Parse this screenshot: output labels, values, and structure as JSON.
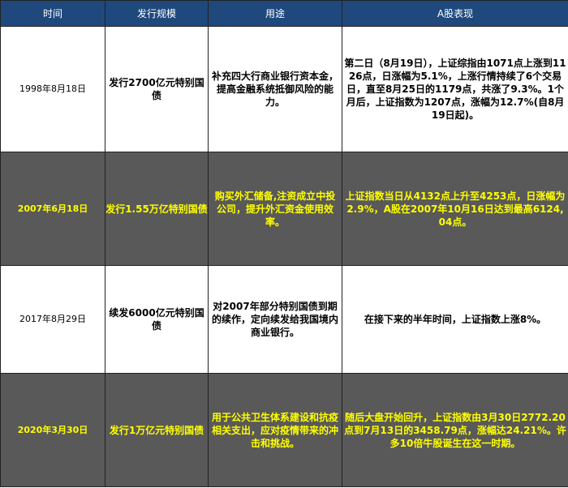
{
  "header": [
    "时间",
    "发行规模",
    "用途",
    "A股表现"
  ],
  "colors": {
    "header_bg": "#1f497d",
    "dark_row_bg": "#595959",
    "dark_row_text": "#ffff00"
  },
  "rows": [
    {
      "style": "light",
      "date": "1998年8月18日",
      "scale": "发行2700亿元特别国债",
      "purpose": "补充四大行商业银行资本金，提高金融系统抵御风险的能力。",
      "performance": "第二日（8月19日），上证综指由1071点上涨到1126点，日涨幅为5.1%，上涨行情持续了6个交易日，直至8月25日的1179点，共涨了9.3%。1个月后，上证指数为1207点，涨幅为12.7%(自8月19日起)。"
    },
    {
      "style": "dark",
      "date": "2007年6月18日",
      "scale": "发行1.55万亿特别国债",
      "purpose": "购买外汇储备,注资成立中投公司，提升外汇资金使用效率。",
      "performance": "上证指数当日从4132点上升至4253点，日涨幅为2.9%，A股在2007年10月16日达到最高6124,04点。"
    },
    {
      "style": "light",
      "date": "2017年8月29日",
      "scale": "续发6000亿元特别国债",
      "purpose": "对2007年部分特别国债到期的续作，定向续发给我国境内商业银行。",
      "performance": "在接下来的半年时间，上证指数上涨8%。"
    },
    {
      "style": "dark",
      "date": "2020年3月30日",
      "scale": "发行1万亿元特别国债",
      "purpose": "用于公共卫生体系建设和抗疫相关支出，应对疫情带来的冲击和挑战。",
      "performance": "随后大盘开始回升，上证指数由3月30日2772.20点到7月13日的3458.79点，涨幅达24.21%。许多10倍牛股诞生在这一时期。"
    }
  ]
}
